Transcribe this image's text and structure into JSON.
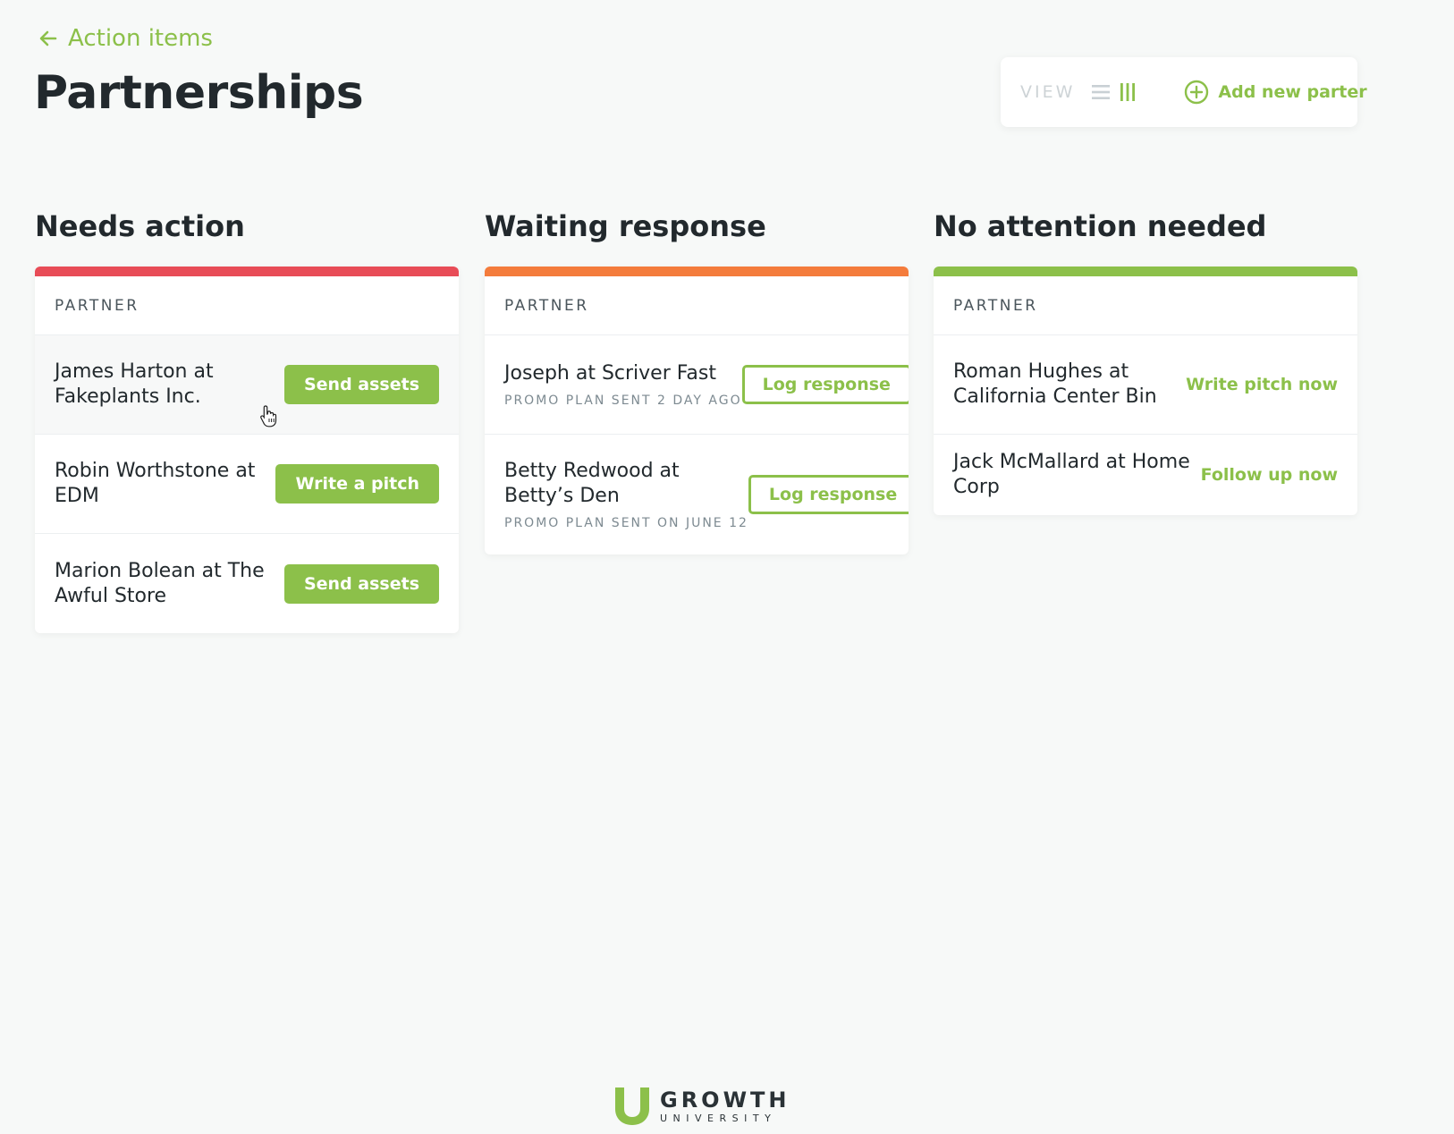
{
  "header": {
    "back_label": "Action items",
    "title": "Partnerships"
  },
  "toolbar": {
    "view_label": "VIEW",
    "add_label": "Add new parter"
  },
  "columns": [
    {
      "title": "Needs action",
      "accent": "#e84c57",
      "header_label": "PARTNER",
      "rows": [
        {
          "name": "James Harton at Fakeplants Inc.",
          "action": "Send assets"
        },
        {
          "name": "Robin Worthstone at EDM",
          "action": "Write a pitch"
        },
        {
          "name": "Marion Bolean at The Awful Store",
          "action": "Send assets"
        }
      ]
    },
    {
      "title": "Waiting response",
      "accent": "#f47c3c",
      "header_label": "PARTNER",
      "rows": [
        {
          "name": "Joseph at Scriver Fast",
          "sub": "PROMO PLAN SENT 2 DAY AGO",
          "action": "Log response"
        },
        {
          "name": "Betty Redwood at Betty’s Den",
          "sub": "PROMO PLAN SENT ON JUNE 12",
          "action": "Log response"
        }
      ]
    },
    {
      "title": "No attention needed",
      "accent": "#8cc04a",
      "header_label": "PARTNER",
      "rows": [
        {
          "name": "Roman Hughes at California Center Bin",
          "action": "Write pitch now"
        },
        {
          "name": "Jack McMallard at Home Corp",
          "action": "Follow up now"
        }
      ]
    }
  ],
  "footer": {
    "logo_main": "GROWTH",
    "logo_sub": "UNIVERSITY"
  },
  "colors": {
    "brand_green": "#8cc04a",
    "needs_action": "#e84c57",
    "waiting": "#f47c3c",
    "ok": "#8cc04a"
  }
}
